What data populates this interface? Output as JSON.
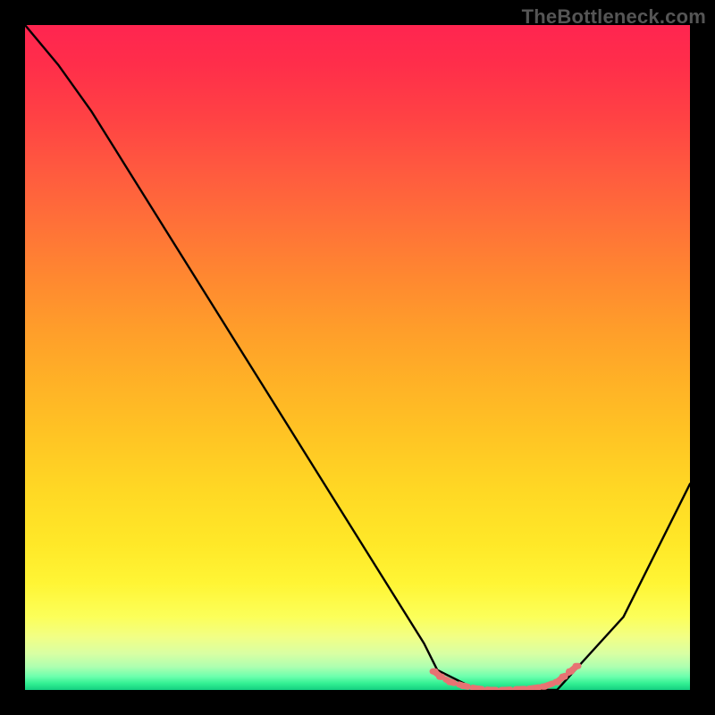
{
  "watermark": "TheBottleneck.com",
  "chart_data": {
    "type": "line",
    "title": "",
    "xlabel": "",
    "ylabel": "",
    "xlim": [
      0,
      100
    ],
    "ylim": [
      0,
      100
    ],
    "series": [
      {
        "name": "curve-black",
        "color": "#000000",
        "x": [
          0,
          5,
          10,
          15,
          20,
          25,
          30,
          35,
          40,
          45,
          50,
          55,
          60,
          62,
          68,
          80,
          90,
          100
        ],
        "y": [
          100,
          94,
          87,
          79,
          71,
          63,
          55,
          47,
          39,
          31,
          23,
          15,
          7,
          3,
          0,
          0,
          11,
          31
        ]
      },
      {
        "name": "marker-pink",
        "color": "#e77373",
        "x": [
          61.5,
          62.5,
          64,
          66,
          68,
          70,
          72,
          74,
          76,
          78,
          80,
          81,
          82,
          83
        ],
        "y": [
          2.8,
          2.0,
          1.2,
          0.6,
          0.2,
          0.0,
          0.0,
          0.1,
          0.2,
          0.5,
          1.2,
          2.0,
          2.8,
          3.6
        ]
      }
    ],
    "background_gradient": {
      "top": "#ff2550",
      "mid": "#ffd824",
      "bottom": "#14d080"
    }
  }
}
